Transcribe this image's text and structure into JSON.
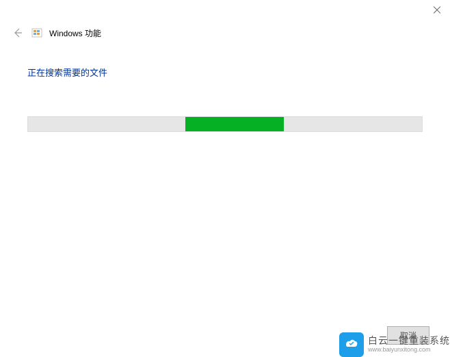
{
  "window": {
    "title": "Windows 功能"
  },
  "content": {
    "status_text": "正在搜索需要的文件",
    "progress": {
      "indeterminate": true,
      "fill_color": "#06b025"
    }
  },
  "footer": {
    "cancel_label": "取消"
  },
  "watermark": {
    "brand": "白云一键重装系统",
    "url": "www.baiyunxitong.com"
  }
}
